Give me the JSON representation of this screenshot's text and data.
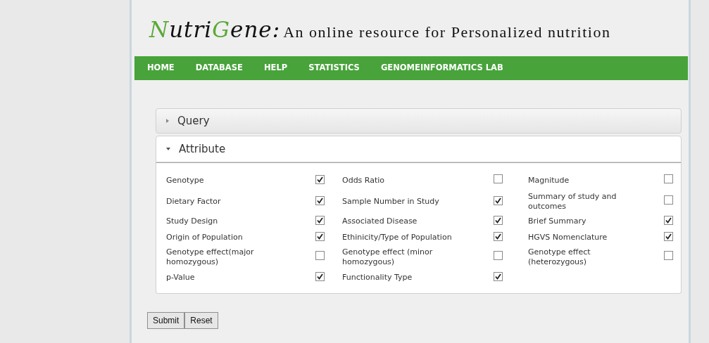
{
  "logo": {
    "parts": [
      {
        "text": "N",
        "accent": true
      },
      {
        "text": "utri",
        "accent": false
      },
      {
        "text": "G",
        "accent": true
      },
      {
        "text": "ene:",
        "accent": false
      }
    ],
    "tagline": "An online resource for Personalized nutrition"
  },
  "nav": [
    {
      "label": "HOME"
    },
    {
      "label": "DATABASE"
    },
    {
      "label": "HELP"
    },
    {
      "label": "STATISTICS"
    },
    {
      "label": "GENOMEINFORMATICS LAB"
    }
  ],
  "sections": [
    {
      "title": "Query",
      "expanded": false
    },
    {
      "title": "Attribute",
      "expanded": true
    }
  ],
  "attributes": [
    [
      {
        "label": "Genotype",
        "checked": true
      },
      {
        "label": "Odds Ratio",
        "checked": false
      },
      {
        "label": "Magnitude",
        "checked": false
      }
    ],
    [
      {
        "label": "Dietary Factor",
        "checked": true
      },
      {
        "label": "Sample Number in Study",
        "checked": true
      },
      {
        "label": "Summary of study and outcomes",
        "checked": false
      }
    ],
    [
      {
        "label": "Study Design",
        "checked": true
      },
      {
        "label": "Associated Disease",
        "checked": true
      },
      {
        "label": "Brief Summary",
        "checked": true
      }
    ],
    [
      {
        "label": "Origin of Population",
        "checked": true
      },
      {
        "label": "Ethinicity/Type of Population",
        "checked": true
      },
      {
        "label": "HGVS Nomenclature",
        "checked": true
      }
    ],
    [
      {
        "label": "Genotype effect(major homozygous)",
        "checked": false
      },
      {
        "label": "Genotype effect (minor homozygous)",
        "checked": false
      },
      {
        "label": "Genotype effect (heterozygous)",
        "checked": false
      }
    ],
    [
      {
        "label": "p-Value",
        "checked": true
      },
      {
        "label": "Functionality Type",
        "checked": true
      }
    ]
  ],
  "buttons": [
    {
      "label": "Submit"
    },
    {
      "label": "Reset"
    }
  ]
}
